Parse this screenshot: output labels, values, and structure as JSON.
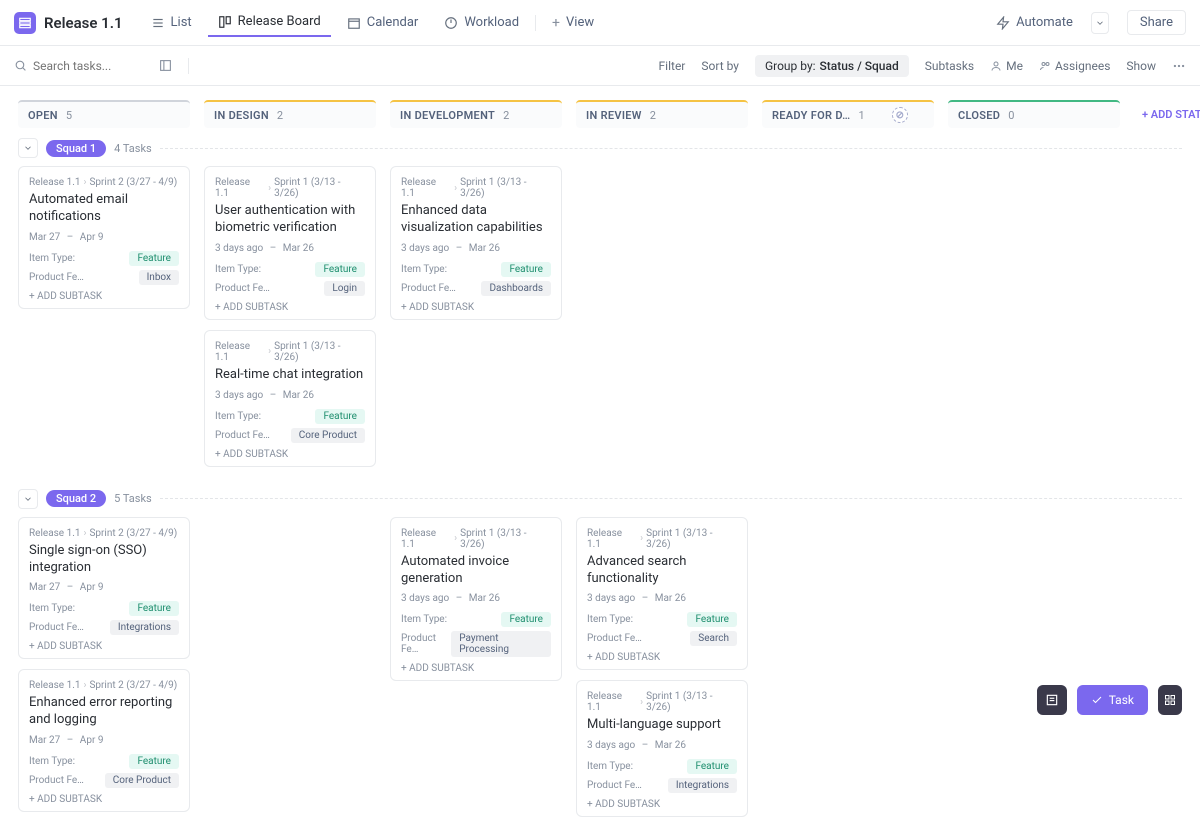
{
  "header": {
    "title": "Release 1.1",
    "views": {
      "list": "List",
      "board": "Release Board",
      "calendar": "Calendar",
      "workload": "Workload",
      "view": "View"
    },
    "automate": "Automate",
    "share": "Share"
  },
  "filter": {
    "search_placeholder": "Search tasks...",
    "filter": "Filter",
    "sort": "Sort by",
    "group_label": "Group by:",
    "group_value": "Status / Squad",
    "subtasks": "Subtasks",
    "me": "Me",
    "assignees": "Assignees",
    "show": "Show"
  },
  "columns": [
    {
      "name": "OPEN",
      "count": "5",
      "color": "#d0d4db"
    },
    {
      "name": "IN DESIGN",
      "count": "2",
      "color": "#f5c344"
    },
    {
      "name": "IN DEVELOPMENT",
      "count": "2",
      "color": "#f5c344"
    },
    {
      "name": "IN REVIEW",
      "count": "2",
      "color": "#f5c344"
    },
    {
      "name": "READY FOR D…",
      "count": "1",
      "color": "#f5c344",
      "dep": true
    },
    {
      "name": "CLOSED",
      "count": "0",
      "color": "#41b883"
    }
  ],
  "add_status": "+ ADD STATUS",
  "lanes": [
    {
      "name": "Squad 1",
      "meta": "4 Tasks",
      "stacks": [
        [
          {
            "crumb1": "Release 1.1",
            "crumb2": "Sprint 2 (3/27 - 4/9)",
            "title": "Automated email notifications",
            "dates": "Mar 27 – Apr 9",
            "chip": "Feature",
            "pf": "Inbox",
            "pf_plain": true
          }
        ],
        [
          {
            "crumb1": "Release 1.1",
            "crumb2": "Sprint 1 (3/13 - 3/26)",
            "title": "User authentication with biometric verification",
            "dates": "3 days ago – Mar 26",
            "chip": "Feature",
            "pf": "Login",
            "pf_plain": true
          },
          {
            "crumb1": "Release 1.1",
            "crumb2": "Sprint 1 (3/13 - 3/26)",
            "title": "Real-time chat integration",
            "dates": "3 days ago – Mar 26",
            "chip": "Feature",
            "pf": "Core Product",
            "pf_plain": true
          }
        ],
        [
          {
            "crumb1": "Release 1.1",
            "crumb2": "Sprint 1 (3/13 - 3/26)",
            "title": "Enhanced data visualization capabilities",
            "dates": "3 days ago – Mar 26",
            "chip": "Feature",
            "pf": "Dashboards",
            "pf_plain": true
          }
        ],
        [],
        [],
        []
      ]
    },
    {
      "name": "Squad 2",
      "meta": "5 Tasks",
      "stacks": [
        [
          {
            "crumb1": "Release 1.1",
            "crumb2": "Sprint 2 (3/27 - 4/9)",
            "title": "Single sign-on (SSO) integration",
            "dates": "Mar 27 – Apr 9",
            "chip": "Feature",
            "pf": "Integrations",
            "pf_plain": true
          },
          {
            "crumb1": "Release 1.1",
            "crumb2": "Sprint 2 (3/27 - 4/9)",
            "title": "Enhanced error reporting and logging",
            "dates": "Mar 27 – Apr 9",
            "chip": "Feature",
            "pf": "Core Product",
            "pf_plain": true
          }
        ],
        [],
        [
          {
            "crumb1": "Release 1.1",
            "crumb2": "Sprint 1 (3/13 - 3/26)",
            "title": "Automated invoice generation",
            "dates": "3 days ago – Mar 26",
            "chip": "Feature",
            "pf": "Payment Processing",
            "pf_plain": true
          }
        ],
        [
          {
            "crumb1": "Release 1.1",
            "crumb2": "Sprint 1 (3/13 - 3/26)",
            "title": "Advanced search functionality",
            "dates": "3 days ago – Mar 26",
            "chip": "Feature",
            "pf": "Search",
            "pf_plain": true
          },
          {
            "crumb1": "Release 1.1",
            "crumb2": "Sprint 1 (3/13 - 3/26)",
            "title": "Multi-language support",
            "dates": "3 days ago – Mar 26",
            "chip": "Feature",
            "pf": "Integrations",
            "pf_plain": true
          }
        ],
        [],
        []
      ]
    }
  ],
  "labels": {
    "item_type": "Item Type:",
    "product_feature": "Product Fe…",
    "add_subtask": "+ ADD SUBTASK"
  },
  "fab": {
    "task": "Task"
  }
}
